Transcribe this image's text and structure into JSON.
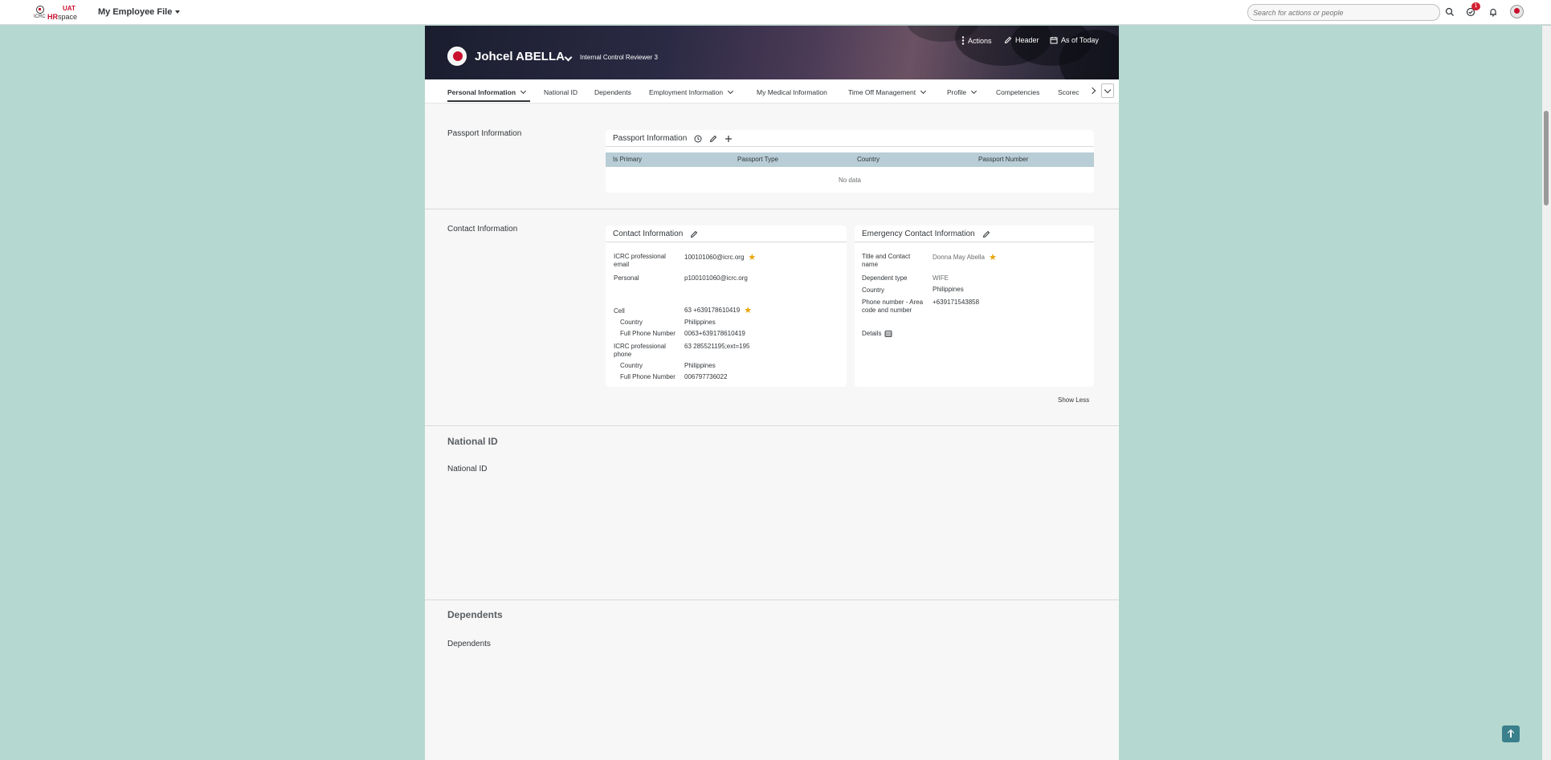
{
  "shell": {
    "logo_uat": "UAT",
    "logo_hr": "HR",
    "logo_space": "space",
    "logo_icrc": "ICRC",
    "app_title": "My Employee File",
    "search_placeholder": "Search for actions or people",
    "notification_count": "1"
  },
  "header": {
    "name": "Johcel ABELLA",
    "position": "Internal Control Reviewer 3",
    "actions_label": "Actions",
    "header_label": "Header",
    "as_of_label": "As of Today"
  },
  "tabs": [
    {
      "label": "Personal Information",
      "has_menu": true,
      "active": true
    },
    {
      "label": "National ID",
      "has_menu": false
    },
    {
      "label": "Dependents",
      "has_menu": false
    },
    {
      "label": "Employment Information",
      "has_menu": true
    },
    {
      "label": "My Medical Information",
      "has_menu": false
    },
    {
      "label": "Time Off Management",
      "has_menu": true
    },
    {
      "label": "Profile",
      "has_menu": true
    },
    {
      "label": "Competencies",
      "has_menu": false
    },
    {
      "label": "Scorec",
      "has_menu": false
    }
  ],
  "passport": {
    "section_label": "Passport Information",
    "card_title": "Passport Information",
    "columns": [
      "Is Primary",
      "Passport Type",
      "Country",
      "Passport Number"
    ],
    "empty_text": "No data"
  },
  "contact": {
    "section_label": "Contact Information",
    "card_title": "Contact Information",
    "icrc_email_label": "ICRC professional email",
    "icrc_email_value": "100101060@icrc.org",
    "personal_label": "Personal",
    "personal_value": "p100101060@icrc.org",
    "cell_label": "Cell",
    "cell_value": "63 +639178610419",
    "cell_country_label": "Country",
    "cell_country_value": "Philippines",
    "cell_full_label": "Full Phone Number",
    "cell_full_value": "0063+639178610419",
    "icrc_phone_label": "ICRC professional phone",
    "icrc_phone_value": "63 285521195;ext=195",
    "phone_country_label": "Country",
    "phone_country_value": "Philippines",
    "phone_full_label": "Full Phone Number",
    "phone_full_value": "006797736022"
  },
  "emergency": {
    "card_title": "Emergency Contact Information",
    "title_name_label": "Title and Contact name",
    "title_name_value": "Donna May Abella",
    "dependent_type_label": "Dependent type",
    "dependent_type_value": "WIFE",
    "country_label": "Country",
    "country_value": "Philippines",
    "phone_label": "Phone number - Area code and number",
    "phone_value": "+639171543858",
    "details_label": "Details"
  },
  "show_less": "Show Less",
  "national_id": {
    "title": "National ID",
    "subsection": "National ID"
  },
  "dependents": {
    "title": "Dependents",
    "subsection": "Dependents"
  },
  "colors": {
    "page_bg": "#b5d8d0",
    "table_header": "#b8cdd6",
    "star": "#e8a400",
    "brand_red": "#c8102e",
    "to_top": "#3a7f8c"
  }
}
